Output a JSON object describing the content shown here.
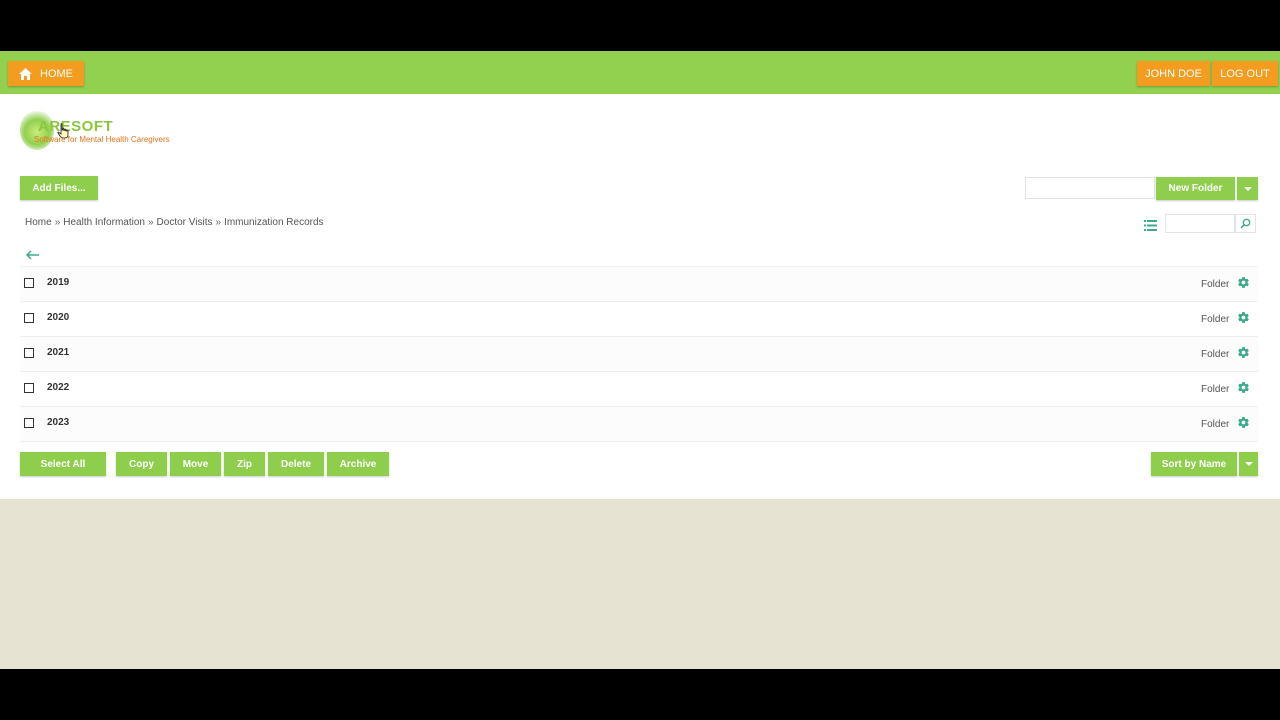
{
  "topbar": {
    "home_label": "HOME",
    "user_label": "JOHN DOE",
    "logout_label": "LOG OUT"
  },
  "logo": {
    "name": "ARESOFT",
    "tagline": "Software for Mental Health Caregivers"
  },
  "toolbar": {
    "add_files_label": "Add Files...",
    "new_folder_label": "New Folder",
    "new_folder_input_value": "",
    "search_value": ""
  },
  "breadcrumb": [
    "Home",
    "Health Information",
    "Doctor Visits",
    "Immunization Records"
  ],
  "items": [
    {
      "name": "2019",
      "type": "Folder"
    },
    {
      "name": "2020",
      "type": "Folder"
    },
    {
      "name": "2021",
      "type": "Folder"
    },
    {
      "name": "2022",
      "type": "Folder"
    },
    {
      "name": "2023",
      "type": "Folder"
    }
  ],
  "actions": {
    "select_all": "Select All",
    "copy": "Copy",
    "move": "Move",
    "zip": "Zip",
    "delete": "Delete",
    "archive": "Archive",
    "sort": "Sort by Name"
  },
  "colors": {
    "brand_green": "#92d050",
    "button_green": "#8fce4c",
    "orange": "#f39c1f",
    "icon_teal": "#3aaa8c"
  },
  "icons": [
    "home-icon",
    "list-view-icon",
    "search-icon",
    "back-arrow-icon",
    "gear-icon",
    "chevron-down-icon"
  ]
}
